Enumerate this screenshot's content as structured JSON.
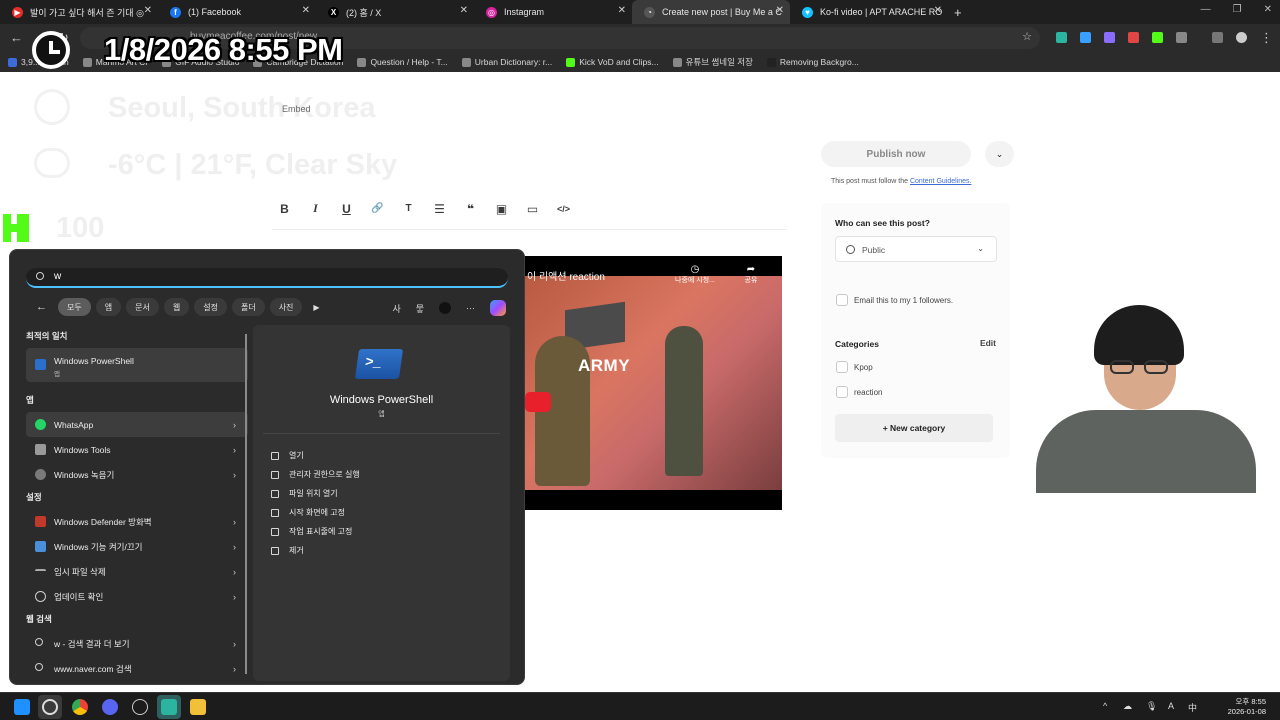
{
  "browser": {
    "tabs": [
      {
        "title": "발이 가고 싶다 해서 즌 기대 ◎",
        "fav_color": "#e52d27",
        "fav_glyph": "▶"
      },
      {
        "title": "(1) Facebook",
        "fav_color": "#1877f2",
        "fav_glyph": "f"
      },
      {
        "title": "(2) 홈 / X",
        "fav_color": "#000000",
        "fav_glyph": "X"
      },
      {
        "title": "Instagram",
        "fav_color": "#d6249f",
        "fav_glyph": "◎"
      },
      {
        "title": "Create new post | Buy Me a C",
        "fav_color": "#555555",
        "fav_glyph": "◔"
      },
      {
        "title": "Ko-fi video | APT ARACHE RO",
        "fav_color": "#13c3ff",
        "fav_glyph": "♥"
      }
    ],
    "new_tab": "+",
    "window_controls": [
      "—",
      "❐",
      "✕"
    ],
    "address": "buymeacoffee.com/post/new",
    "bookmarks": [
      "3,9... free an",
      "Marimo Art Cr",
      "GIF Audio Studio",
      "Cambridge Dictation",
      "Question / Help - T...",
      "Urban Dictionary: r...",
      "Kick VoD and Clips...",
      "유튜브 썸네일 저장",
      "Removing Backgro..."
    ]
  },
  "overlay": {
    "datetime": "1/8/2026 8:55 PM",
    "location": "Seoul, South Korea",
    "weather": "-6°C | 21°F, Clear Sky",
    "viewer_count": "100"
  },
  "editor": {
    "heading": "Embed",
    "format_tools": [
      "B",
      "I",
      "U",
      "🔗",
      "T",
      "☰",
      "❝",
      "▣",
      "▭",
      "</>"
    ],
    "video": {
      "title": "이 리액션 reaction",
      "watch_later": "나중에 시청...",
      "share": "공유",
      "brand": "ARMY"
    }
  },
  "sidebar": {
    "publish_label": "Publish now",
    "publish_more": "⌄",
    "guideline_prefix": "This post must follow the ",
    "guideline_link": "Content Guidelines.",
    "visibility_heading": "Who can see this post?",
    "visibility_value": "Public",
    "email_label": "Email this to my 1 followers.",
    "categories_heading": "Categories",
    "categories_edit": "Edit",
    "categories": [
      "Kpop",
      "reaction"
    ],
    "new_category": "+ New category"
  },
  "start_search": {
    "query": "w",
    "filters": [
      "모두",
      "앱",
      "문서",
      "웹",
      "설정",
      "폴더",
      "사진"
    ],
    "active_filter": "모두",
    "right_icons": [
      "사",
      "뭏",
      "···"
    ],
    "sections": {
      "best_match": "최적의 일치",
      "apps": "앱",
      "settings": "설정",
      "web": "웹 검색"
    },
    "best_match_item": {
      "name": "Windows PowerShell",
      "kind": "앱"
    },
    "app_items": [
      {
        "name": "WhatsApp",
        "icon_color": "#25d366"
      },
      {
        "name": "Windows Tools",
        "icon_color": "#9a9a9a"
      },
      {
        "name": "Windows 녹음기",
        "icon_color": "#7a7a7a"
      }
    ],
    "setting_items": [
      {
        "name": "Windows Defender 방화벽",
        "icon_color": "#c0392b"
      },
      {
        "name": "Windows 기능 켜기/끄기",
        "icon_color": "#4a90d9"
      },
      {
        "name": "임시 파일 삭제",
        "icon_color": "#aaaaaa"
      },
      {
        "name": "업데이트 확인",
        "icon_color": "#3aa0ff"
      }
    ],
    "web_items": [
      {
        "name": "w - 검색 결과 더 보기"
      },
      {
        "name": "www.naver.com 검색"
      }
    ],
    "detail": {
      "name": "Windows PowerShell",
      "kind": "앱",
      "actions": [
        "열기",
        "관리자 권한으로 실행",
        "파일 위치 열기",
        "시작 화면에 고정",
        "작업 표시줄에 고정",
        "제거"
      ]
    }
  },
  "taskbar": {
    "tray_time": "오후 8:55",
    "tray_date": "2026-01-08",
    "tray_icons": [
      "^",
      "☁",
      "🎙",
      "A",
      "中"
    ]
  }
}
